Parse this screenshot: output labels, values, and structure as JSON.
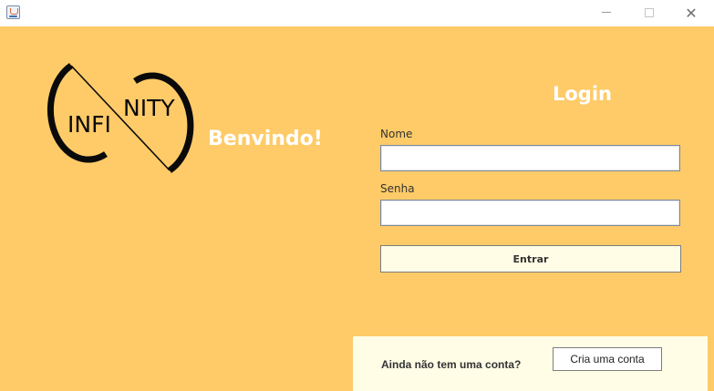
{
  "window": {
    "minimize_icon": "minimize-icon",
    "maximize_icon": "maximize-icon",
    "close_icon": "close-icon"
  },
  "logo": {
    "left_text": "INFI",
    "right_text": "NITY"
  },
  "welcome": "Benvindo!",
  "login": {
    "title": "Login",
    "name_label": "Nome",
    "name_value": "",
    "password_label": "Senha",
    "password_value": "",
    "submit_label": "Entrar"
  },
  "signup": {
    "prompt": "Ainda não tem uma conta?",
    "button_label": "Cria uma conta"
  },
  "colors": {
    "background": "#fecb68",
    "panel": "#fffde6",
    "text_light": "#ffffff"
  }
}
